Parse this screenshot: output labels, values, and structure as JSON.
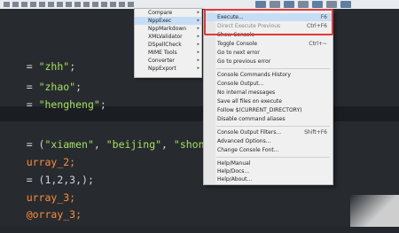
{
  "editor": {
    "lines": [
      {
        "parts": [
          {
            "t": "= ",
            "c": "op"
          },
          {
            "t": "\"zhh\"",
            "c": "str"
          },
          {
            "t": ";",
            "c": "punct"
          }
        ]
      },
      {
        "parts": [
          {
            "t": "= ",
            "c": "op"
          },
          {
            "t": "\"zhao\"",
            "c": "str"
          },
          {
            "t": ";",
            "c": "punct"
          }
        ]
      },
      {
        "parts": [
          {
            "t": "= ",
            "c": "op"
          },
          {
            "t": "\"hengheng\"",
            "c": "str"
          },
          {
            "t": ";",
            "c": "punct"
          }
        ]
      },
      {
        "parts": [
          {
            "t": "= (",
            "c": "op"
          },
          {
            "t": "\"xiamen\"",
            "c": "str"
          },
          {
            "t": ", ",
            "c": "punct"
          },
          {
            "t": "\"beijing\"",
            "c": "str"
          },
          {
            "t": ", ",
            "c": "punct"
          },
          {
            "t": "\"shonghao\"",
            "c": "str"
          },
          {
            "t": ");",
            "c": "punct"
          }
        ]
      },
      {
        "parts": [
          {
            "t": "urray_2;",
            "c": "ident"
          }
        ]
      },
      {
        "parts": [
          {
            "t": "= (1,2,3,);",
            "c": "op"
          }
        ]
      },
      {
        "parts": [
          {
            "t": "urray_3;",
            "c": "ident"
          }
        ]
      },
      {
        "parts": [
          {
            "t": "@orray_3;",
            "c": "ident"
          }
        ]
      }
    ]
  },
  "plugins_submenu": {
    "items": [
      {
        "label": "Compare",
        "has_arrow": true,
        "highlighted": false
      },
      {
        "label": "NppExec",
        "has_arrow": true,
        "highlighted": true
      },
      {
        "label": "NppMarkdown",
        "has_arrow": true,
        "highlighted": false
      },
      {
        "label": "XMLValidator",
        "has_arrow": true,
        "highlighted": false
      },
      {
        "label": "DSpellCheck",
        "has_arrow": true,
        "highlighted": false
      },
      {
        "label": "MIME Tools",
        "has_arrow": true,
        "highlighted": false
      },
      {
        "label": "Converter",
        "has_arrow": true,
        "highlighted": false
      },
      {
        "label": "NppExport",
        "has_arrow": true,
        "highlighted": false
      }
    ]
  },
  "nppexec_menu": {
    "items": [
      {
        "label": "Execute...",
        "shortcut": "F6",
        "highlighted": true
      },
      {
        "label": "Direct Execute Previous",
        "shortcut": "Ctrl+F6",
        "grey": true
      },
      {
        "label": "Show Console",
        "shortcut": ""
      },
      {
        "label": "Toggle Console",
        "shortcut": "Ctrl+~"
      },
      {
        "label": "Go to next error",
        "shortcut": ""
      },
      {
        "label": "Go to previous error",
        "shortcut": ""
      },
      {
        "sep": true
      },
      {
        "label": "Console Commands History",
        "shortcut": ""
      },
      {
        "label": "Console Output...",
        "shortcut": ""
      },
      {
        "label": "No internal messages",
        "shortcut": ""
      },
      {
        "label": "Save all files on execute",
        "shortcut": ""
      },
      {
        "label": "Follow $(CURRENT_DIRECTORY)",
        "shortcut": ""
      },
      {
        "label": "Disable command aliases",
        "shortcut": ""
      },
      {
        "sep": true
      },
      {
        "label": "Console Output Filters...",
        "shortcut": "Shift+F6"
      },
      {
        "label": "Advanced Options...",
        "shortcut": ""
      },
      {
        "label": "Change Console Font...",
        "shortcut": ""
      },
      {
        "sep": true
      },
      {
        "label": "Help/Manual",
        "shortcut": ""
      },
      {
        "label": "Help/Docs...",
        "shortcut": ""
      },
      {
        "label": "Help/About...",
        "shortcut": ""
      }
    ]
  },
  "colors": {
    "highlight_box": "#e03a3a",
    "string": "#a5e05f",
    "identifier": "#ff8c3a"
  }
}
